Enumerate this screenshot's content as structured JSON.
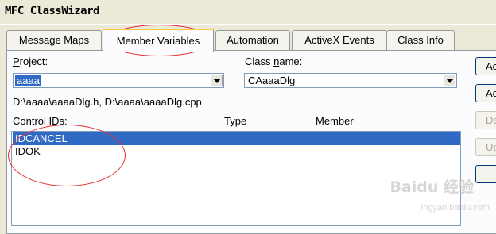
{
  "window": {
    "title": "MFC ClassWizard"
  },
  "tabs": [
    {
      "label": "Message Maps",
      "active": false
    },
    {
      "label": "Member Variables",
      "active": true
    },
    {
      "label": "Automation",
      "active": false
    },
    {
      "label": "ActiveX Events",
      "active": false
    },
    {
      "label": "Class Info",
      "active": false
    }
  ],
  "project": {
    "label_u": "P",
    "label_rest": "roject:",
    "value": "aaaa"
  },
  "class_name": {
    "label_pre": "Class ",
    "label_u": "n",
    "label_rest": "ame:",
    "value": "CAaaaDlg"
  },
  "files_text": "D:\\aaaa\\aaaaDlg.h, D:\\aaaa\\aaaaDlg.cpp",
  "list": {
    "headers": {
      "control_ids": "Control IDs:",
      "type": "Type",
      "member": "Member"
    },
    "rows": [
      {
        "id": "IDCANCEL",
        "selected": true
      },
      {
        "id": "IDOK",
        "selected": false
      }
    ]
  },
  "buttons": [
    {
      "label": "Ac",
      "enabled": true
    },
    {
      "label": "Ac",
      "enabled": true
    },
    {
      "label": "De",
      "enabled": false
    },
    {
      "label": "Up",
      "enabled": false
    },
    {
      "label": "",
      "enabled": true
    }
  ],
  "watermark": {
    "brand": "Baidu 经验",
    "url": "jingyan.baidu.com"
  },
  "colors": {
    "selection": "#316ac5",
    "annotation": "#e53030",
    "tab_highlight": "#ffc83c"
  }
}
